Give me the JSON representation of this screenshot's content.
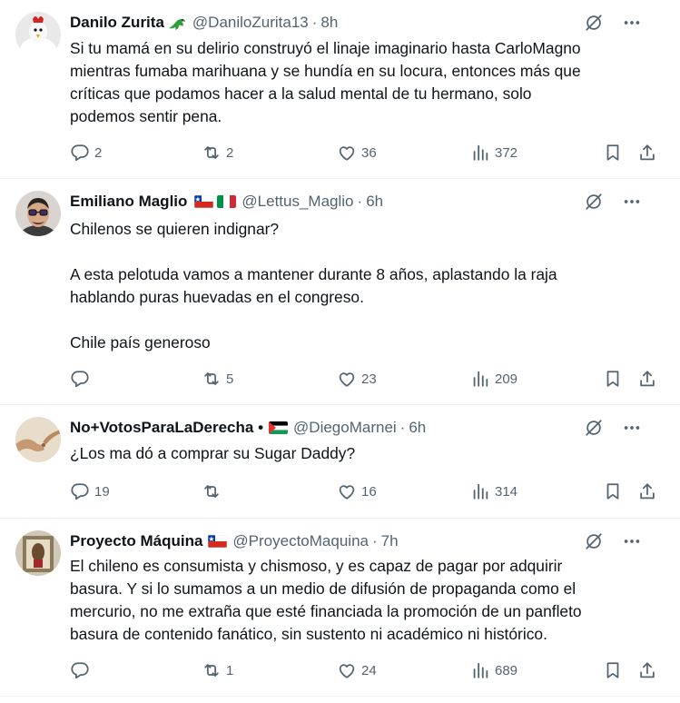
{
  "tweets": [
    {
      "name": "Danilo Zurita",
      "handle": "@DaniloZurita13",
      "sep": "·",
      "time": "8h",
      "text": "Si tu mamá en su delirio construyó el linaje imaginario hasta CarloMagno\nmientras fumaba marihuana y se hundía en su locura, entonces más que\ncríticas que podamos hacer a la salud mental de tu hermano, solo\npodemos sentir pena.",
      "replies": "2",
      "retweets": "2",
      "likes": "36",
      "views": "372"
    },
    {
      "name": "Emiliano Maglio",
      "handle": "@Lettus_Maglio",
      "sep": "·",
      "time": "6h",
      "text": "Chilenos se quieren indignar?\n\nA esta pelotuda vamos a mantener durante 8 años, aplastando la raja\nhablando puras huevadas en el congreso.\n\nChile país generoso",
      "replies": "",
      "retweets": "5",
      "likes": "23",
      "views": "209"
    },
    {
      "name": "No+VotosParaLaDerecha •",
      "handle": "@DiegoMarnei",
      "sep": "·",
      "time": "6h",
      "text": "¿Los ma dó a comprar su Sugar Daddy?",
      "replies": "19",
      "retweets": "",
      "likes": "16",
      "views": "314"
    },
    {
      "name": "Proyecto Máquina",
      "handle": "@ProyectoMaquina",
      "sep": "·",
      "time": "7h",
      "text": "El chileno es consumista y chismoso, y es capaz de pagar por adquirir\nbasura. Y si lo sumamos a un medio de difusión de propaganda como el\nmercurio, no me extraña que esté financiada la promoción de un panfleto\nbasura de contenido fanático, sin sustento ni académico ni histórico.",
      "replies": "",
      "retweets": "1",
      "likes": "24",
      "views": "689"
    }
  ],
  "colors": {
    "text": "#0f1419",
    "secondary": "#536471",
    "divider": "#eff3f4",
    "lizard": "#2e9e3a"
  },
  "icons": [
    "grok-icon",
    "more-icon",
    "reply-icon",
    "retweet-icon",
    "like-icon",
    "views-icon",
    "bookmark-icon",
    "share-icon",
    "lizard-icon",
    "chile-flag-icon",
    "italy-flag-icon",
    "palestine-flag-icon"
  ]
}
